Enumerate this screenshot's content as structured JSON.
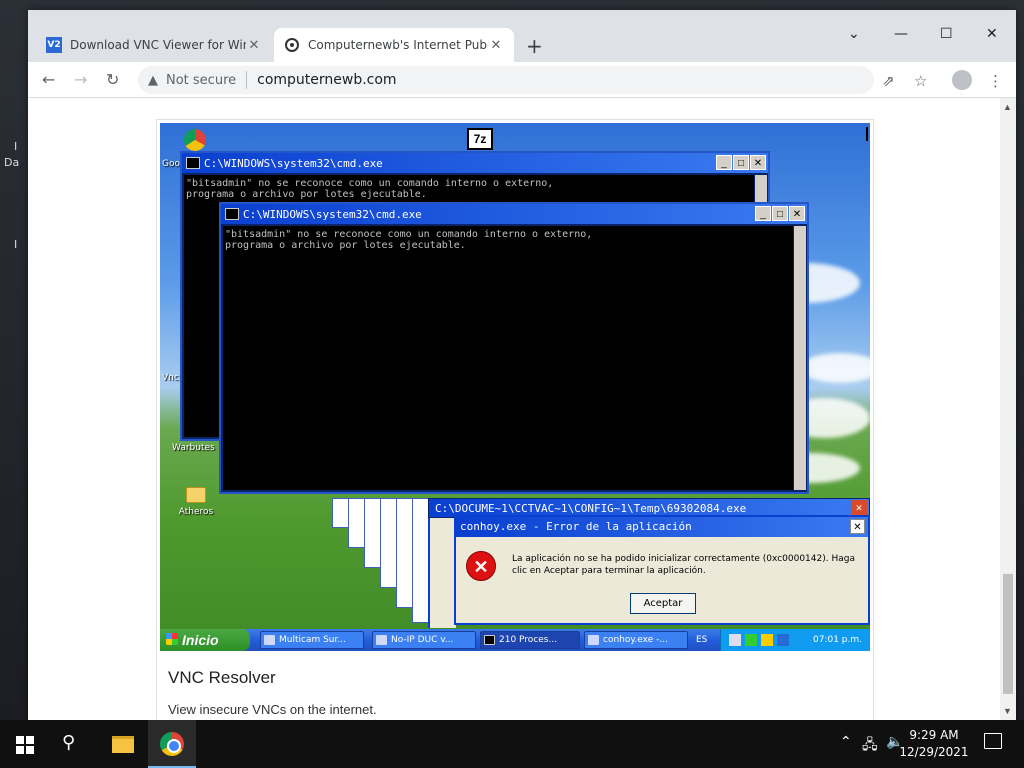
{
  "browser": {
    "tabs": [
      {
        "label": "Download VNC Viewer for Windo",
        "favicon": "V2"
      },
      {
        "label": "Computernewb's Internet Pub H",
        "favicon": "pub-icon"
      }
    ],
    "security_label": "Not secure",
    "url": "computernewb.com",
    "new_tab": "+",
    "accent": "#dee1e6"
  },
  "card": {
    "title": "VNC Resolver",
    "description": "View insecure VNCs on the internet."
  },
  "remote_desktop": {
    "cmd_windows": [
      {
        "title": "C:\\WINDOWS\\system32\\cmd.exe",
        "text": "\"bitsadmin\" no se reconoce como un comando interno o externo,\nprograma o archivo por lotes ejecutable."
      },
      {
        "title": "C:\\WINDOWS\\system32\\cmd.exe",
        "text": "\"bitsadmin\" no se reconoce como un comando interno o externo,\nprograma o archivo por lotes ejecutable."
      }
    ],
    "parent_window_title": "C:\\DOCUME~1\\CCTVAC~1\\CONFIG~1\\Temp\\69302084.exe",
    "error_dialog": {
      "title": "conhoy.exe - Error de la aplicación",
      "message": "La aplicación no se ha podido inicializar correctamente (0xc0000142). Haga clic en Aceptar para terminar la aplicación.",
      "button": "Aceptar"
    },
    "desktop_icons": [
      "Atheros",
      "Warbutes",
      "Goo",
      "Vnc"
    ],
    "seven_zip": "7z",
    "taskbar": {
      "start": "Inicio",
      "buttons": [
        "Multicam Sur...",
        "No-IP DUC v...",
        "210 Proces...",
        "conhoy.exe -..."
      ],
      "lang": "ES",
      "time": "07:01 p.m."
    }
  },
  "windows_taskbar": {
    "time": "9:29 AM",
    "date": "12/29/2021"
  },
  "desktop_left_labels": [
    "I",
    "Da",
    "I"
  ]
}
